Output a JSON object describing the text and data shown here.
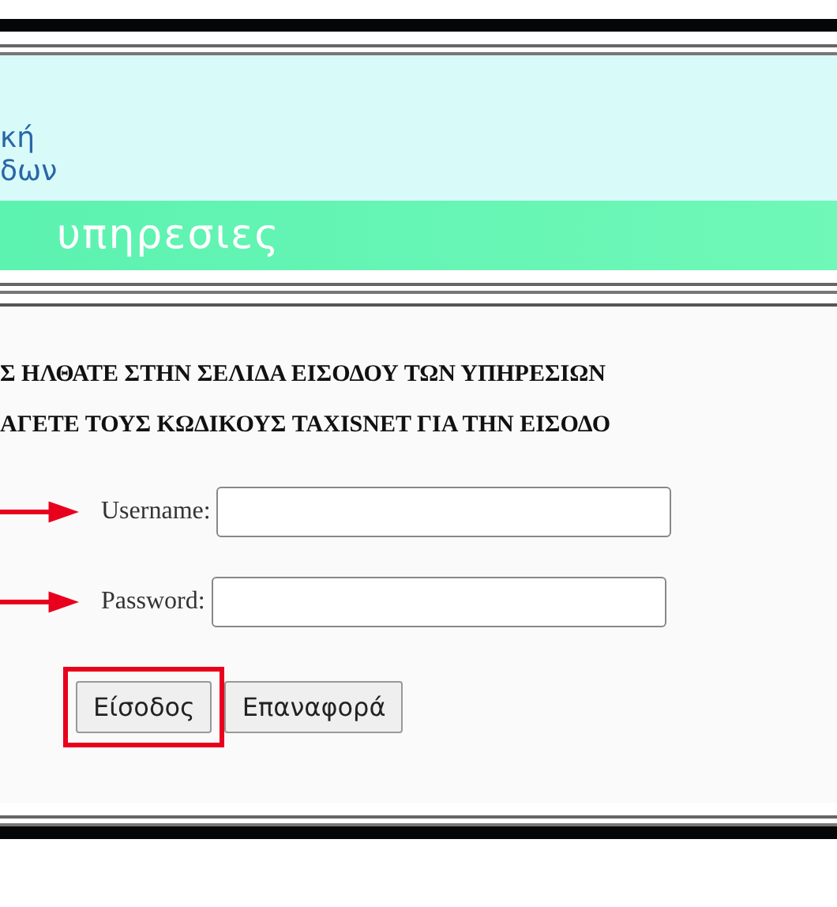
{
  "header": {
    "logo_lines": [
      "κή",
      "δων"
    ],
    "banner": "υπηρεσιες"
  },
  "notice": {
    "lines": [
      "Σ ΗΛΘΑΤΕ ΣΤΗΝ ΣΕΛΙΔΑ ΕΙΣΟΔΟΥ ΤΩΝ ΥΠΗΡΕΣΙΩΝ",
      "ΑΓΕΤΕ ΤΟΥΣ ΚΩΔΙΚΟΥΣ TAXISNET ΓΙΑ ΤΗΝ ΕΙΣΟΔΟ"
    ]
  },
  "form": {
    "fields": [
      {
        "label": "Username:",
        "pointed": true
      },
      {
        "label": "Password:",
        "pointed": true
      }
    ],
    "buttons": [
      {
        "label": "Είσοδος",
        "highlighted": true
      },
      {
        "label": "Επαναφορά",
        "highlighted": false
      }
    ]
  }
}
